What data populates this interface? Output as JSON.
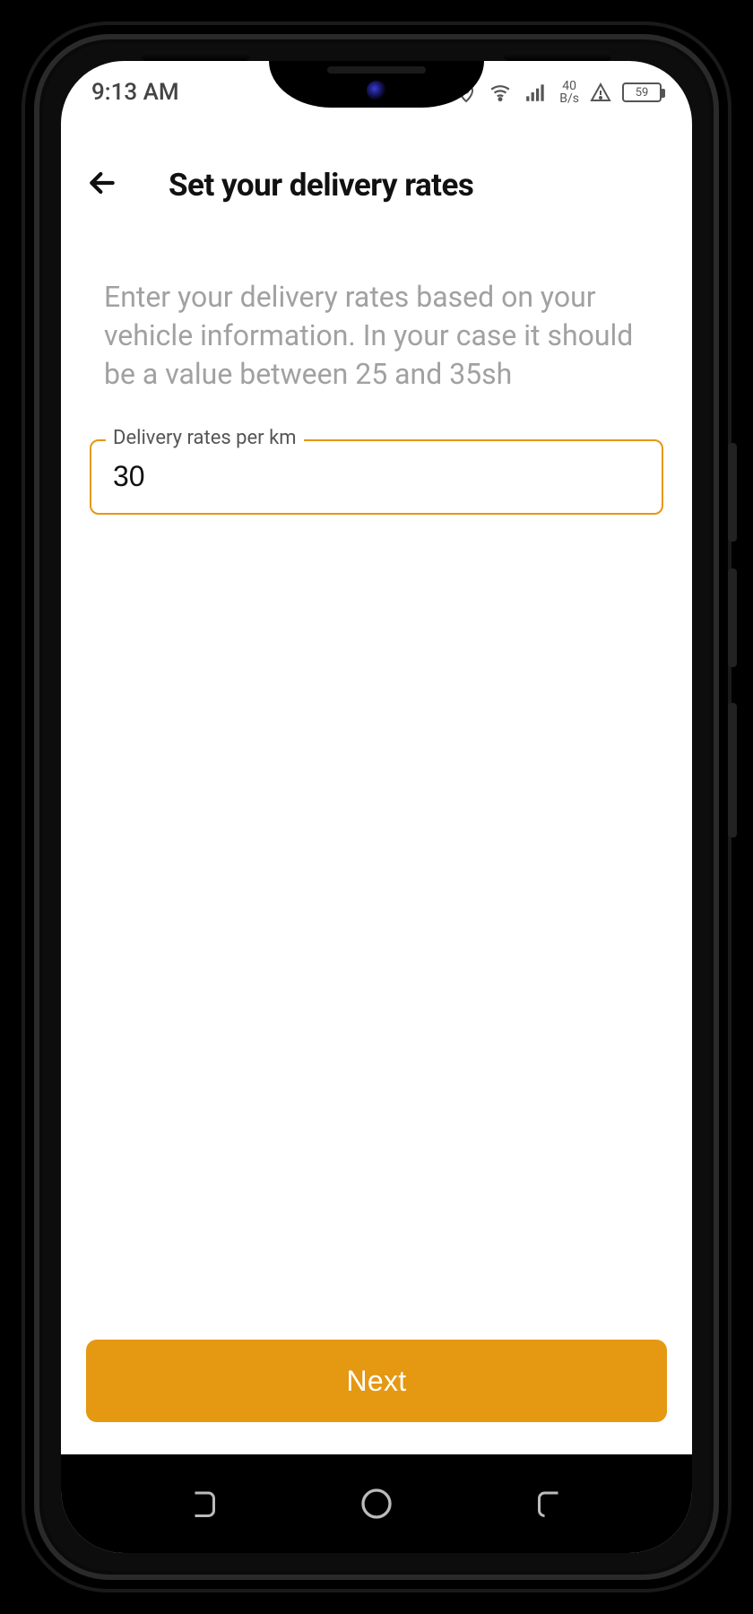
{
  "statusbar": {
    "time": "9:13 AM",
    "net_rate_value": "40",
    "net_rate_unit": "B/s",
    "battery_percent": "59"
  },
  "header": {
    "title": "Set your delivery rates"
  },
  "instruction": "Enter your delivery rates based on your vehicle information. In your case it should be a value between 25 and 35sh",
  "field": {
    "label": "Delivery rates per km",
    "value": "30"
  },
  "actions": {
    "next_label": "Next"
  },
  "colors": {
    "accent": "#e59812"
  }
}
